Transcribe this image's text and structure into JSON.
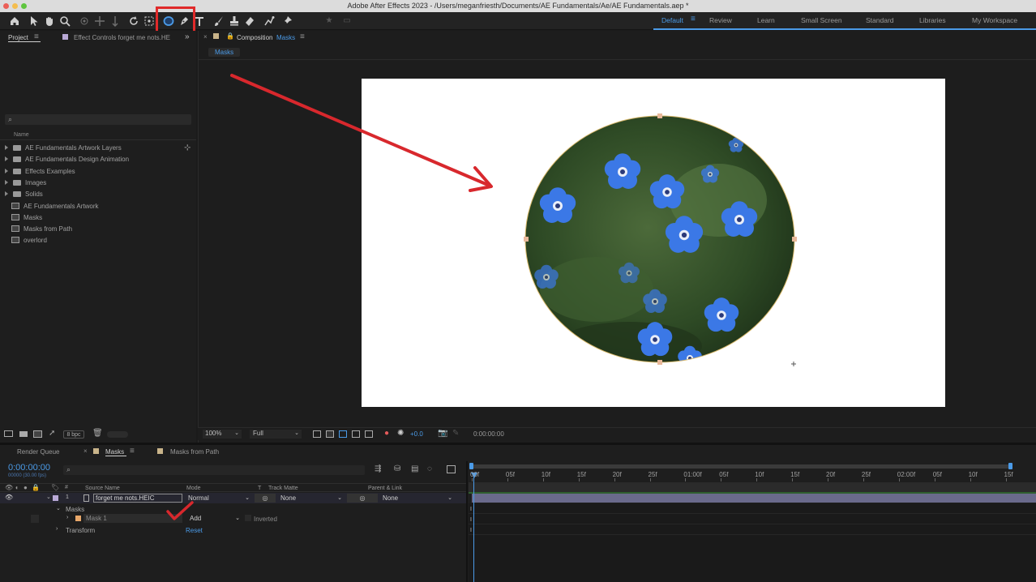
{
  "window": {
    "title": "Adobe After Effects 2023 - /Users/meganfriesth/Documents/AE Fundamentals/Ae/AE Fundamentals.aep *"
  },
  "colors": {
    "accent": "#4b9be8",
    "highlight_red": "#e02a2a",
    "label_tan": "#c9b48a",
    "label_orange": "#e8a86a",
    "timeline_bar": "#6a6a8c"
  },
  "toolbar": {
    "icons": [
      "home-icon",
      "selection-tool-icon",
      "hand-tool-icon",
      "zoom-tool-icon",
      "orbit-camera-icon",
      "pan-camera-icon",
      "dolly-camera-icon",
      "rotation-tool-icon",
      "anchor-point-tool-icon",
      "ellipse-tool-icon",
      "pen-tool-icon",
      "type-tool-icon",
      "brush-tool-icon",
      "clone-stamp-icon",
      "eraser-tool-icon",
      "roto-brush-icon",
      "puppet-pin-icon"
    ],
    "workspaces": [
      "Default",
      "Review",
      "Learn",
      "Small Screen",
      "Standard",
      "Libraries",
      "My Workspace"
    ],
    "active_workspace": "Default"
  },
  "project_panel": {
    "tab_project": "Project",
    "tab_effect_controls": "Effect Controls forget me nots.HE",
    "search_placeholder": "",
    "column_name": "Name",
    "items": [
      {
        "label": "AE Fundamentals Artwork Layers",
        "type": "folder"
      },
      {
        "label": "AE Fundamentals Design Animation",
        "type": "folder"
      },
      {
        "label": "Effects Examples",
        "type": "folder"
      },
      {
        "label": "Images",
        "type": "folder"
      },
      {
        "label": "Solids",
        "type": "folder"
      },
      {
        "label": "AE Fundamentals Artwork",
        "type": "comp"
      },
      {
        "label": "Masks",
        "type": "comp"
      },
      {
        "label": "Masks from Path",
        "type": "comp"
      },
      {
        "label": "overlord",
        "type": "comp"
      }
    ],
    "bpc": "8 bpc"
  },
  "composition_panel": {
    "tab_prefix": "Composition",
    "tab_name": "Masks",
    "breadcrumb": "Masks",
    "zoom": "100%",
    "resolution": "Full",
    "exposure": "+0.0",
    "timecode": "0:00:00:00"
  },
  "timeline": {
    "tabs": [
      "Render Queue",
      "Masks",
      "Masks from Path"
    ],
    "timecode": "0:00:00:00",
    "fps_label": "00000 (30.00 fps)",
    "columns": {
      "source_name": "Source Name",
      "mode": "Mode",
      "t": "T",
      "track_matte": "Track Matte",
      "parent": "Parent & Link"
    },
    "layer": {
      "index": "1",
      "name": "forget me nots.HEIC",
      "mode": "Normal",
      "track_matte": "None",
      "parent": "None"
    },
    "masks_group": "Masks",
    "mask": {
      "name": "Mask 1",
      "mode": "Add",
      "inverted": "Inverted"
    },
    "transform": "Transform",
    "reset": "Reset",
    "ruler": [
      "00f",
      "05f",
      "10f",
      "15f",
      "20f",
      "25f",
      "01:00f",
      "05f",
      "10f",
      "15f",
      "20f",
      "25f",
      "02:00f",
      "05f",
      "10f",
      "15f"
    ]
  }
}
